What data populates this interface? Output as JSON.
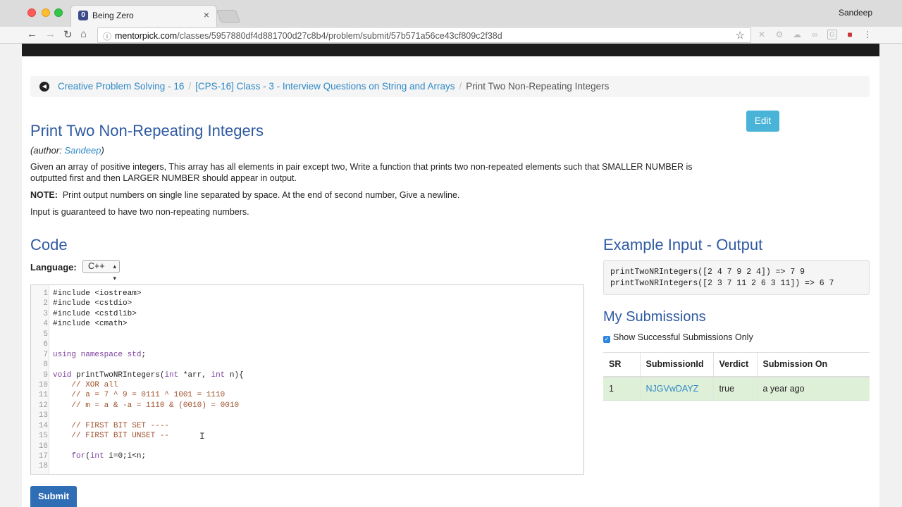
{
  "browser": {
    "tab_title": "Being Zero",
    "tab_favicon": "0",
    "profile_name": "Sandeep",
    "url_host": "mentorpick.com",
    "url_path": "/classes/5957880df4d881700d27c8b4/problem/submit/57b571a56ce43cf809c2f38d"
  },
  "breadcrumb": {
    "items": [
      "Creative Problem Solving - 16",
      "[CPS-16] Class - 3 - Interview Questions on String and Arrays"
    ],
    "current": "Print Two Non-Repeating Integers",
    "separator": "/"
  },
  "problem": {
    "edit_label": "Edit",
    "title": "Print Two Non-Repeating Integers",
    "author_prefix": "(author: ",
    "author_name": "Sandeep",
    "author_suffix": ")",
    "description": "Given an array of positive integers, This array has all elements in pair except two, Write a function that prints two non-repeated elements such that SMALLER NUMBER is outputted first and then LARGER NUMBER should appear in output.",
    "note_label": "NOTE:",
    "note_text": "Print output numbers on single line separated by space.  At the end of second number, Give a newline.",
    "guarantee": "Input is guaranteed to have two non-repeating numbers."
  },
  "code": {
    "heading": "Code",
    "language_label": "Language:",
    "language_value": "C++",
    "lines": [
      {
        "n": "1",
        "t": "#include <iostream>"
      },
      {
        "n": "2",
        "t": "#include <cstdio>"
      },
      {
        "n": "3",
        "t": "#include <cstdlib>"
      },
      {
        "n": "4",
        "t": "#include <cmath>"
      },
      {
        "n": "5",
        "t": ""
      },
      {
        "n": "6",
        "t": ""
      },
      {
        "n": "7",
        "t": "using namespace std;"
      },
      {
        "n": "8",
        "t": ""
      },
      {
        "n": "9",
        "t": "void printTwoNRIntegers(int *arr, int n){"
      },
      {
        "n": "10",
        "t": "    // XOR all"
      },
      {
        "n": "11",
        "t": "    // a = 7 ^ 9 = 0111 ^ 1001 = 1110"
      },
      {
        "n": "12",
        "t": "    // m = a & -a = 1110 & (0010) = 0010"
      },
      {
        "n": "13",
        "t": ""
      },
      {
        "n": "14",
        "t": "    // FIRST BIT SET ----"
      },
      {
        "n": "15",
        "t": "    // FIRST BIT UNSET --"
      },
      {
        "n": "16",
        "t": ""
      },
      {
        "n": "17",
        "t": "    for(int i=0;i<n;"
      },
      {
        "n": "18",
        "t": ""
      }
    ],
    "submit_label": "Submit"
  },
  "example": {
    "heading": "Example Input - Output",
    "line1": "printTwoNRIntegers([2 4 7 9 2 4]) => 7 9",
    "line2": "printTwoNRIntegers([2 3 7 11 2 6 3 11]) => 6 7"
  },
  "submissions": {
    "heading": "My Submissions",
    "checkbox_label": "Show Successful Submissions Only",
    "checked": true,
    "columns": [
      "SR",
      "SubmissionId",
      "Verdict",
      "Submission On"
    ],
    "rows": [
      {
        "sr": "1",
        "id": "NJGVwDAYZ",
        "verdict": "true",
        "on": "a year ago"
      }
    ]
  },
  "colors": {
    "heading_blue": "#2f5aa2",
    "link_blue": "#2f89c6",
    "edit_button": "#49b3d8",
    "submit_button": "#2f6db5",
    "success_row": "#dff0d8"
  }
}
